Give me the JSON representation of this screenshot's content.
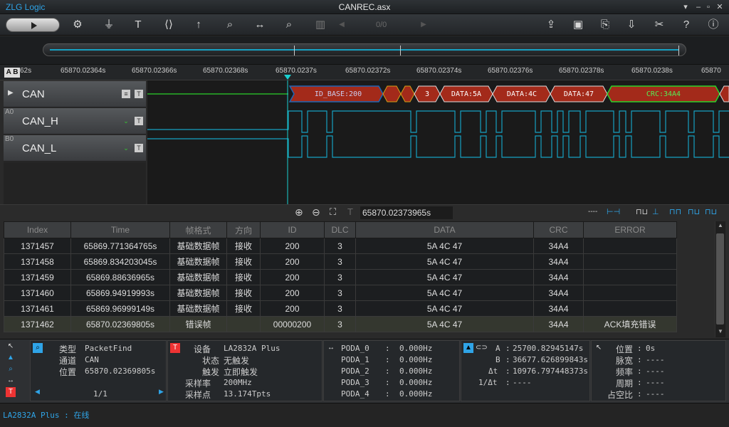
{
  "app": {
    "name": "ZLG Logic",
    "window_title": "CANREC.asx"
  },
  "toolbar": {
    "page_counter": "0/0"
  },
  "ruler": {
    "ab_label": "A B",
    "ticks": [
      "62s",
      "65870.02364s",
      "65870.02366s",
      "65870.02368s",
      "65870.0237s",
      "65870.02372s",
      "65870.02374s",
      "65870.02376s",
      "65870.02378s",
      "65870.0238s",
      "65870"
    ]
  },
  "channels": [
    {
      "num": "",
      "name": "CAN"
    },
    {
      "num": "A0",
      "name": "CAN_H"
    },
    {
      "num": "B0",
      "name": "CAN_L"
    }
  ],
  "decode": {
    "fields": [
      "ID_BASE:200",
      "3",
      "DATA:5A",
      "DATA:4C",
      "DATA:47",
      "CRC:34A4"
    ]
  },
  "zoombar": {
    "cursor_time": "65870.02373965s"
  },
  "table": {
    "headers": [
      "Index",
      "Time",
      "帧格式",
      "方向",
      "ID",
      "DLC",
      "DATA",
      "CRC",
      "ERROR"
    ],
    "rows": [
      [
        "1371457",
        "65869.771364765s",
        "基础数据帧",
        "接收",
        "200",
        "3",
        "5A 4C 47",
        "34A4",
        ""
      ],
      [
        "1371458",
        "65869.834203045s",
        "基础数据帧",
        "接收",
        "200",
        "3",
        "5A 4C 47",
        "34A4",
        ""
      ],
      [
        "1371459",
        "65869.88636965s",
        "基础数据帧",
        "接收",
        "200",
        "3",
        "5A 4C 47",
        "34A4",
        ""
      ],
      [
        "1371460",
        "65869.94919993s",
        "基础数据帧",
        "接收",
        "200",
        "3",
        "5A 4C 47",
        "34A4",
        ""
      ],
      [
        "1371461",
        "65869.96999149s",
        "基础数据帧",
        "接收",
        "200",
        "3",
        "5A 4C 47",
        "34A4",
        ""
      ],
      [
        "1371462",
        "65870.02369805s",
        "错误帧",
        "",
        "00000200",
        "3",
        "5A 4C 47",
        "34A4",
        "ACK填充错误"
      ]
    ]
  },
  "search_panel": {
    "labels": [
      "类型",
      "通道",
      "位置"
    ],
    "values": [
      "PacketFind",
      "CAN",
      "65870.02369805s"
    ],
    "pager": "1/1"
  },
  "device_panel": {
    "labels": [
      "设备",
      "状态",
      "触发",
      "采样率",
      "采样点"
    ],
    "values": [
      "LA2832A Plus",
      "无触发",
      "立即触发",
      "200MHz",
      "13.174Tpts"
    ]
  },
  "freq_panel": {
    "labels": [
      "PODA_0",
      "PODA_1",
      "PODA_2",
      "PODA_3",
      "PODA_4"
    ],
    "values": [
      "0.000Hz",
      "0.000Hz",
      "0.000Hz",
      "0.000Hz",
      "0.000Hz"
    ]
  },
  "cursor_panel": {
    "labels": [
      "A",
      "B",
      "Δt",
      "1/Δt"
    ],
    "values": [
      "25700.82945147s",
      "36677.626899843s",
      "10976.797448373s",
      "----"
    ]
  },
  "measure_panel": {
    "labels": [
      "位置",
      "脉宽",
      "频率",
      "周期",
      "占空比"
    ],
    "values": [
      "0s",
      "----",
      "----",
      "----",
      "----"
    ]
  },
  "status": {
    "text": "LA2832A Plus : 在线"
  },
  "colors": {
    "accent": "#2fa4e7",
    "wave": "#16a1c2",
    "cursor": "#19d0d0",
    "decode_frame": "#a32a1a",
    "decode_id": "#1f66b5",
    "trigger_green": "#2ad12a"
  }
}
